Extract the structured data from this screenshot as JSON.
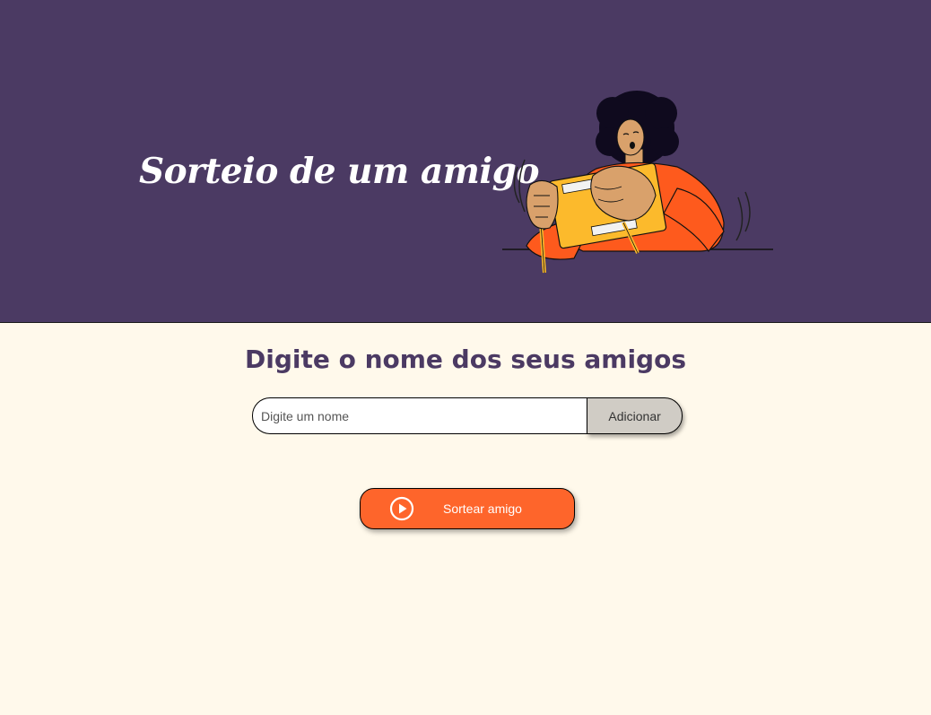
{
  "header": {
    "title": "Sorteio de um amigo",
    "illustration_icon": "person-holding-gift-box-illustration"
  },
  "main": {
    "section_title": "Digite o nome dos seus amigos",
    "name_input": {
      "placeholder": "Digite um nome",
      "value": ""
    },
    "add_button_label": "Adicionar",
    "draw_button": {
      "label": "Sortear amigo",
      "icon": "play-circle-icon"
    }
  },
  "colors": {
    "header_background": "#4B3A63",
    "page_background": "#FFF9EB",
    "accent_orange": "#FE652B",
    "add_button_background": "#D0CCC5",
    "title_color": "#4B3A63"
  }
}
